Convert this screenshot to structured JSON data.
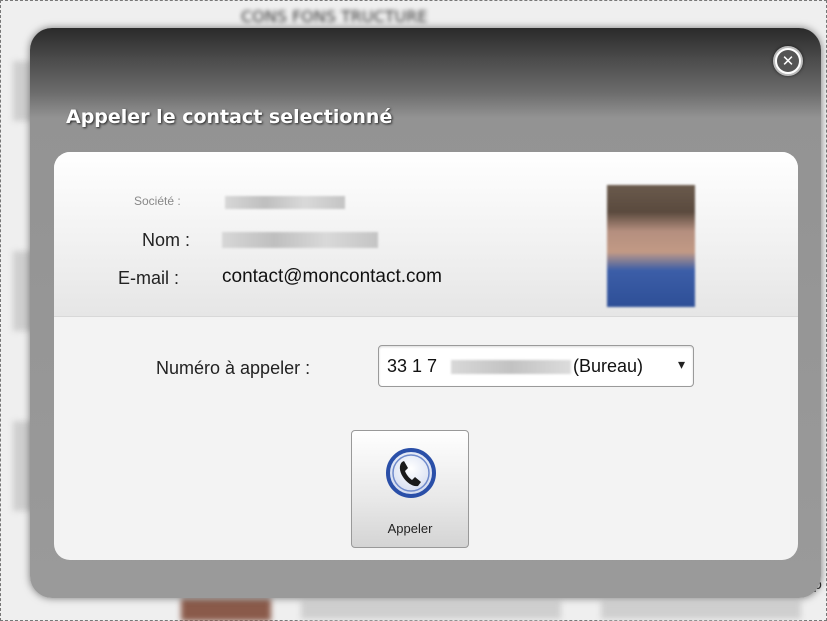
{
  "background": {
    "title_fragment": "CONS   FONS   TRUCTURE",
    "edge_letter": "p"
  },
  "dialog": {
    "title": "Appeler le contact selectionné",
    "close_icon": "close-circle-icon"
  },
  "contact": {
    "societe_label": "Société :",
    "nom_label": "Nom :",
    "email_label": "E-mail :",
    "email_value": "contact@moncontact.com",
    "avatar_icon": "contact-photo"
  },
  "phone": {
    "label": "Numéro à appeler :",
    "selected_prefix": "33 1 7",
    "selected_suffix": "(Bureau)",
    "arrow": "▾"
  },
  "call_button": {
    "label": "Appeler",
    "icon": "phone-icon",
    "icon_color": "#2a4fa8"
  }
}
